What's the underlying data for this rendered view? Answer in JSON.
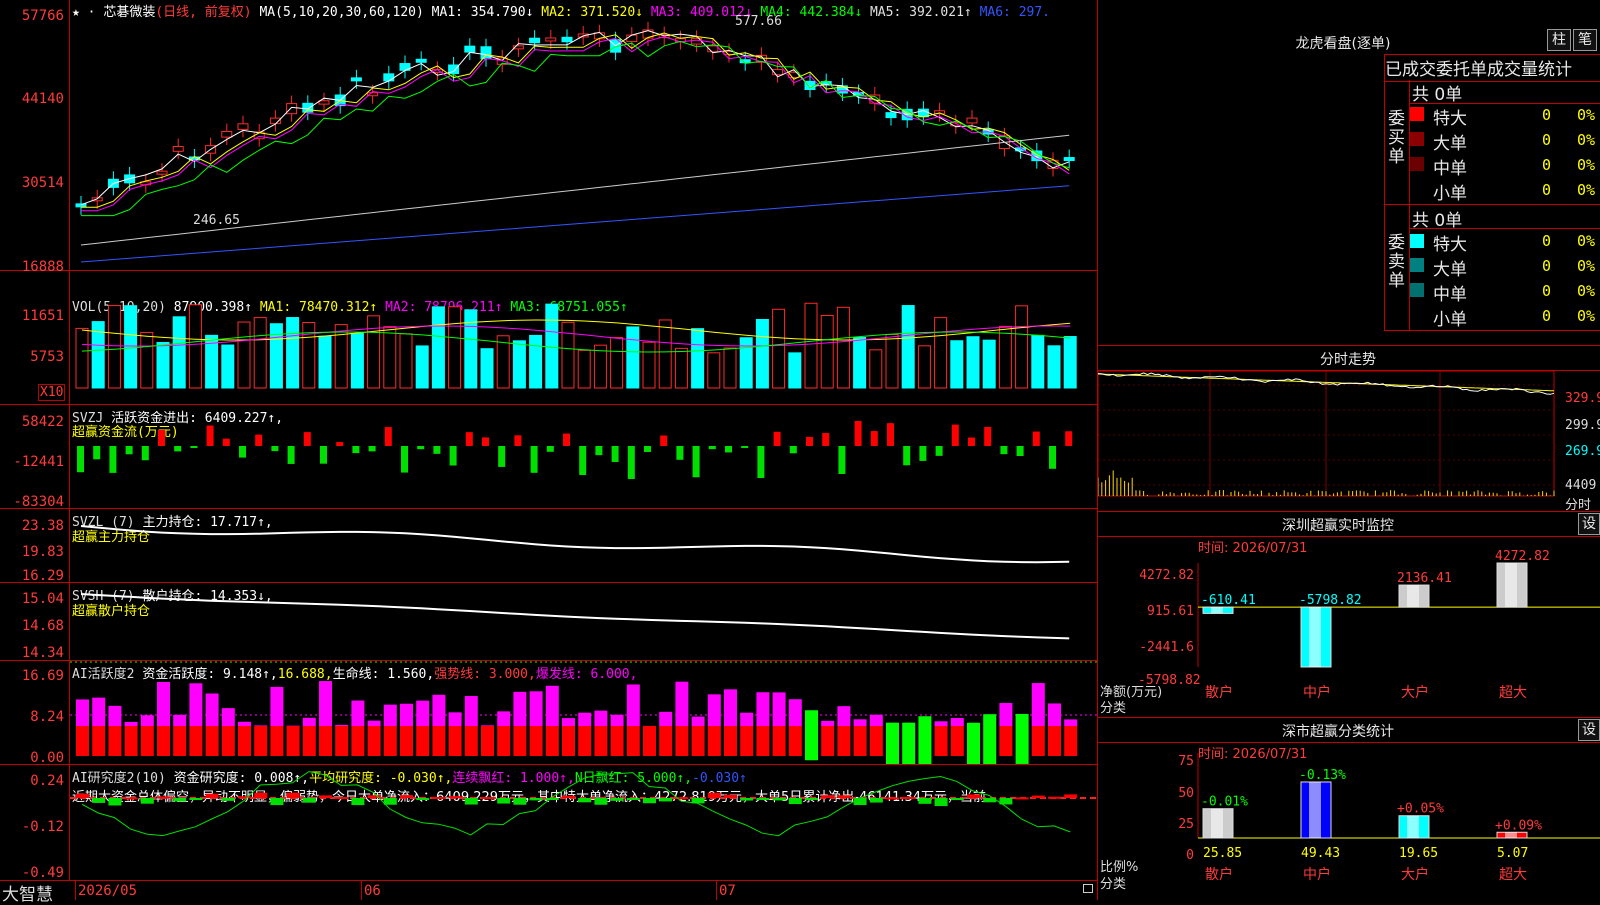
{
  "stock": {
    "name": "芯碁微装",
    "period": "(日线, 前复权)",
    "ma_label": "MA(5,10,20,30,60,120)",
    "ma_values": [
      {
        "text": "MA1: 354.790↓",
        "color": "#ffffff"
      },
      {
        "text": "MA2: 371.520↓",
        "color": "#ffff00"
      },
      {
        "text": "MA3: 409.012↓",
        "color": "#ff00ff"
      },
      {
        "text": "MA4: 442.384↓",
        "color": "#00ff00"
      },
      {
        "text": "MA5: 392.021↑",
        "color": "#e0e0e0"
      },
      {
        "text": "MA6: 297.",
        "color": "#3355ff"
      }
    ],
    "high_marker": "577.66",
    "low_marker": "246.65",
    "price_axis": [
      "57766",
      "44140",
      "30514",
      "16888"
    ],
    "dates": [
      "2026/05",
      "06",
      "07"
    ]
  },
  "vol": {
    "label": "VOL(5,10,20)",
    "value": "87900.398↑",
    "ma1": "MA1: 78470.312↑",
    "ma2": "MA2: 78796.211↑",
    "ma3": "MA3: 68751.055↑",
    "axis": [
      "11651",
      "5753"
    ],
    "scale": "X10"
  },
  "svzj": {
    "label": "SVZJ",
    "name": "活跃资金进出: 6409.227↑,",
    "sub": "超赢资金流(万元)",
    "axis": [
      "58422",
      "-12441",
      "-83304"
    ]
  },
  "svzl": {
    "label": "SVZL (7)",
    "name": "主力持仓: 17.717↑,",
    "sub": "超赢主力持仓",
    "axis": [
      "23.38",
      "19.83",
      "16.29"
    ]
  },
  "svsh": {
    "label": "SVSH (7)",
    "name": "散户持仓: 14.353↓,",
    "sub": "超赢散户持仓",
    "axis": [
      "15.04",
      "14.68",
      "14.34"
    ]
  },
  "ai1": {
    "label": "AI活跃度2",
    "parts": [
      {
        "text": "资金活跃度: 9.148↑,",
        "color": "#ffffff"
      },
      {
        "text": "16.688,",
        "color": "#ffff00"
      },
      {
        "text": "生命线: 1.560,",
        "color": "#ffffff"
      },
      {
        "text": "强势线: 3.000,",
        "color": "#ff3b3b"
      },
      {
        "text": "爆发线: 6.000,",
        "color": "#ff00ff"
      }
    ],
    "axis": [
      "16.69",
      "8.24",
      "0.00"
    ]
  },
  "ai2": {
    "label": "AI研究度2(10)",
    "parts": [
      {
        "text": "资金研究度: 0.008↑,",
        "color": "#ffffff"
      },
      {
        "text": "平均研究度: -0.030↑,",
        "color": "#ffff00"
      },
      {
        "text": "连续飘红: 1.000↑,",
        "color": "#ff00ff"
      },
      {
        "text": "N日飘红: 5.000↑,",
        "color": "#00ff00"
      },
      {
        "text": "-0.030↑",
        "color": "#3355ff"
      }
    ],
    "summary": "近期大资金总体偏空，异动不明显，偏弱势，今日大单净流入：6409.229万元，其中特大单净流入：4272.819万元，大单5日累计净出-46141.34万元，当前",
    "axis": [
      "0.24",
      "-0.12",
      "-0.49"
    ]
  },
  "brand": "大智慧",
  "right": {
    "top_title": "龙虎看盘(逐单)",
    "btn_bar": "柱",
    "btn_pen": "笔",
    "tabs": [
      "已成交",
      "委托单",
      "成交量",
      "统计"
    ],
    "buy_label": "委买单",
    "sell_label": "委卖单",
    "buy_total": "共 0单",
    "sell_total": "共 0单",
    "rows": [
      "特大",
      "大单",
      "中单",
      "小单"
    ],
    "row_counts": [
      "0",
      "0",
      "0",
      "0"
    ],
    "row_pcts": [
      "0%",
      "0%",
      "0%",
      "0%"
    ],
    "buy_colors": [
      "#ff0000",
      "#8b0000",
      "#6b0000",
      "#000000"
    ],
    "sell_colors": [
      "#00ffff",
      "#008080",
      "#007070",
      "#000000"
    ],
    "intraday_title": "分时走势",
    "intraday_axis": [
      "329.9",
      "299.9",
      "269.9"
    ],
    "intraday_vol": "4409",
    "intraday_footer": "分时",
    "monitor_title": "深圳超赢实时监控",
    "monitor_btn": "设",
    "monitor_time": "时间: 2026/07/31",
    "monitor_axis": [
      "4272.82",
      "915.61",
      "-2441.6",
      "-5798.82"
    ],
    "monitor_ylabel": "净额(万元)",
    "monitor_xlabel": "分类",
    "stats_title": "深市超赢分类统计",
    "stats_btn": "设",
    "stats_time": "时间: 2026/07/31",
    "stats_axis": [
      "75",
      "50",
      "25",
      "0"
    ],
    "stats_ylabel": "比例%",
    "stats_xlabel": "分类"
  },
  "chart_data": [
    {
      "type": "bar",
      "title": "深圳超赢实时监控",
      "ylabel": "净额(万元)",
      "xlabel": "分类",
      "categories": [
        "散户",
        "中户",
        "大户",
        "超大"
      ],
      "values": [
        -610.41,
        -5798.82,
        2136.41,
        4272.82
      ],
      "ylim": [
        -5798.82,
        4272.82
      ]
    },
    {
      "type": "bar",
      "title": "深市超赢分类统计",
      "ylabel": "比例%",
      "xlabel": "分类",
      "categories": [
        "散户",
        "中户",
        "大户",
        "超大"
      ],
      "values": [
        25.85,
        49.43,
        19.65,
        5.07
      ],
      "changes": [
        "-0.01%",
        "-0.13%",
        "+0.05%",
        "+0.09%"
      ],
      "ylim": [
        0,
        75
      ]
    }
  ]
}
